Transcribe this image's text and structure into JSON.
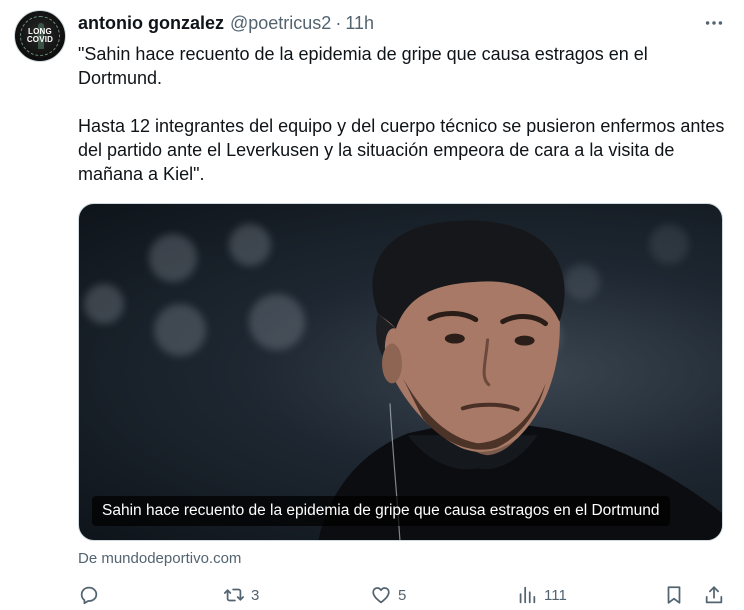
{
  "author": {
    "avatar_text": [
      "LONG",
      "COVID"
    ],
    "name": "antonio gonzalez",
    "handle": "@poetricus2",
    "separator": "·",
    "time": "11h"
  },
  "tweet": {
    "paragraphs": [
      "\"Sahin hace recuento de la epidemia de gripe que causa estragos en el Dortmund.",
      "Hasta 12 integrantes del equipo y del cuerpo técnico se pusieron enfermos antes del partido ante el Leverkusen y la situación empeora de cara a la visita de mañana a Kiel\"."
    ]
  },
  "card": {
    "caption": "Sahin hace recuento de la epidemia de gripe que causa estragos en el Dortmund",
    "source": "De mundodeportivo.com"
  },
  "actions": {
    "reply_count": "",
    "retweet_count": "3",
    "like_count": "5",
    "views_count": "111"
  },
  "icons": {
    "more": "more-icon",
    "reply": "reply-icon",
    "retweet": "retweet-icon",
    "like": "like-icon",
    "views": "views-icon",
    "bookmark": "bookmark-icon",
    "share": "share-icon"
  }
}
